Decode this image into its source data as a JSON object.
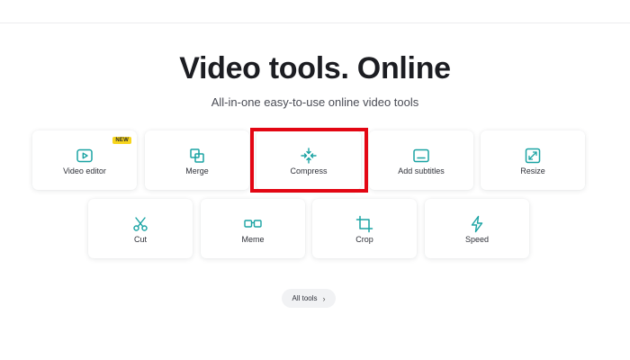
{
  "header": {
    "title": "Video tools. Online",
    "subtitle": "All-in-one easy-to-use online video tools"
  },
  "tools_row1": [
    {
      "label": "Video editor",
      "icon": "play-icon",
      "badge": "NEW"
    },
    {
      "label": "Merge",
      "icon": "merge-icon"
    },
    {
      "label": "Compress",
      "icon": "compress-icon"
    },
    {
      "label": "Add subtitles",
      "icon": "subtitles-icon"
    },
    {
      "label": "Resize",
      "icon": "resize-icon"
    }
  ],
  "tools_row2": [
    {
      "label": "Cut",
      "icon": "scissors-icon"
    },
    {
      "label": "Meme",
      "icon": "glasses-icon"
    },
    {
      "label": "Crop",
      "icon": "crop-icon"
    },
    {
      "label": "Speed",
      "icon": "lightning-icon"
    }
  ],
  "all_tools_label": "All tools",
  "colors": {
    "accent": "#1aa3a3",
    "highlight": "#e30613",
    "badge": "#f7d51d"
  }
}
